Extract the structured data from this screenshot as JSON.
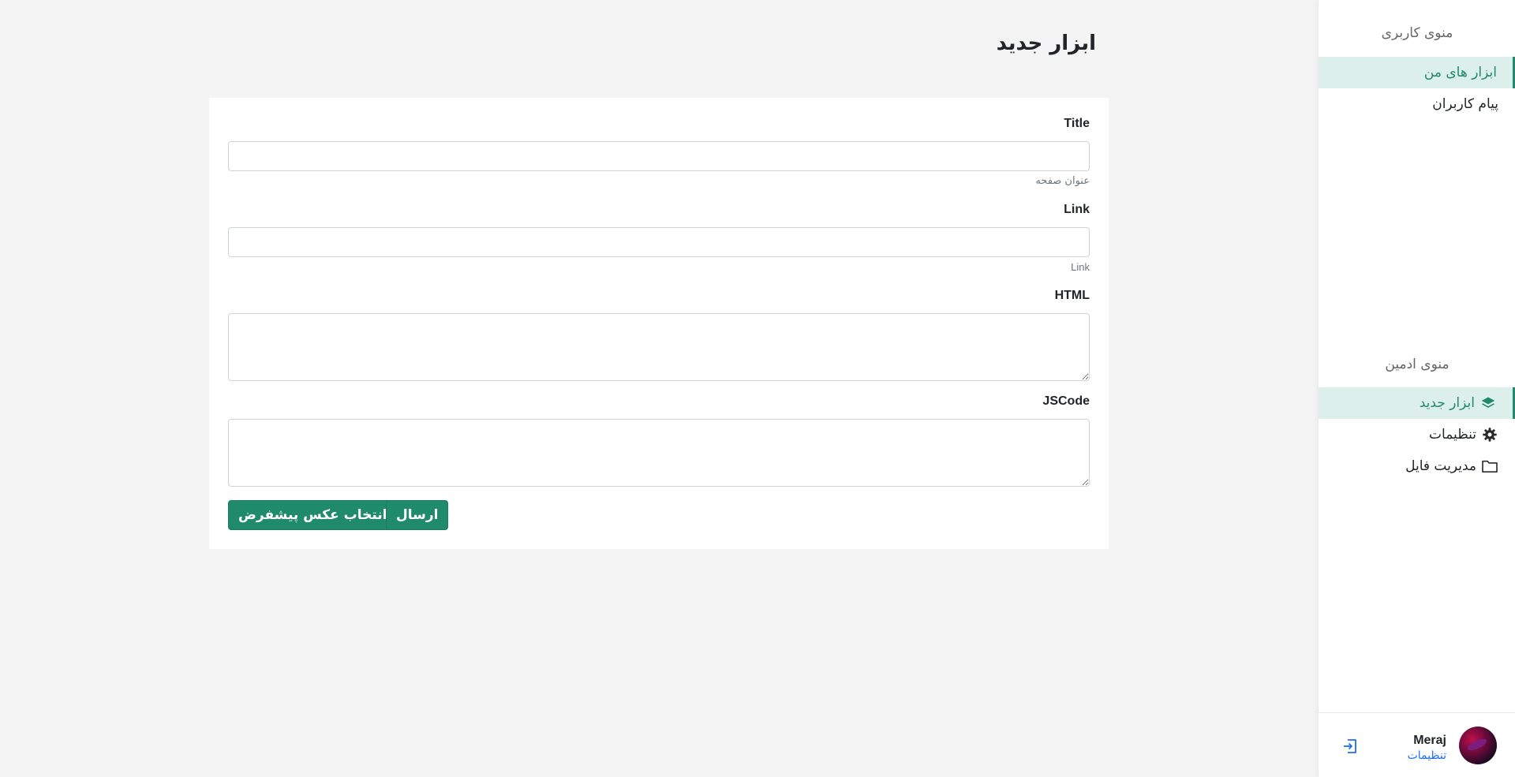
{
  "page": {
    "title": "ابزار جدید"
  },
  "form": {
    "title": {
      "label": "Title",
      "value": "",
      "help": "عنوان صفحه"
    },
    "link": {
      "label": "Link",
      "value": "",
      "help": "Link"
    },
    "html": {
      "label": "HTML",
      "value": ""
    },
    "jscode": {
      "label": "JSCode",
      "value": ""
    },
    "buttons": {
      "submit": "ارسال",
      "choose_image": "انتخاب عکس پیشفرض"
    }
  },
  "sidebar": {
    "user_menu": {
      "heading": "منوی کاربری",
      "items": [
        {
          "label": "ابزار های من",
          "active": true
        },
        {
          "label": "پیام کاربران",
          "active": false
        }
      ]
    },
    "admin_menu": {
      "heading": "منوی ادمین",
      "items": [
        {
          "label": "ابزار جدید",
          "icon": "layers-icon",
          "active": true
        },
        {
          "label": "تنظیمات",
          "icon": "gear-icon",
          "active": false
        },
        {
          "label": "مدیریت فایل",
          "icon": "folder-icon",
          "active": false
        }
      ]
    },
    "user": {
      "name": "Meraj",
      "settings_link": "تنظیمات"
    }
  },
  "colors": {
    "accent": "#1f8a6c",
    "active_bg": "#dcefea",
    "link": "#1b6ef3",
    "background": "#f4f4f4"
  }
}
